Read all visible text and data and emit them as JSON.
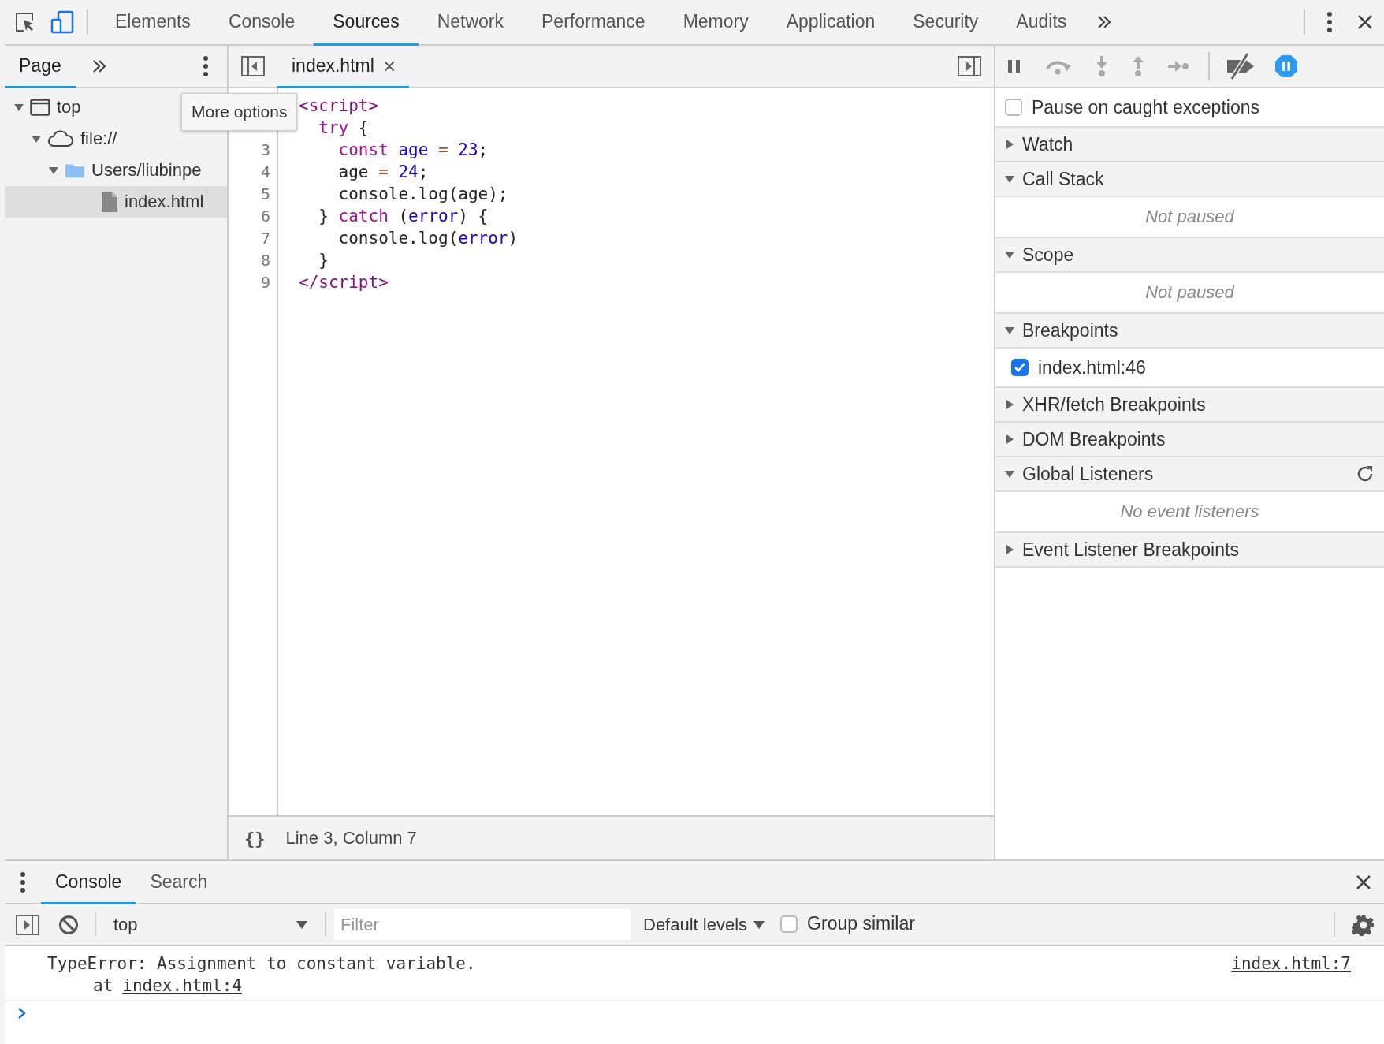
{
  "devtools_tabs": [
    {
      "label": "Elements",
      "selected": false
    },
    {
      "label": "Console",
      "selected": false
    },
    {
      "label": "Sources",
      "selected": true
    },
    {
      "label": "Network",
      "selected": false
    },
    {
      "label": "Performance",
      "selected": false
    },
    {
      "label": "Memory",
      "selected": false
    },
    {
      "label": "Application",
      "selected": false
    },
    {
      "label": "Security",
      "selected": false
    },
    {
      "label": "Audits",
      "selected": false
    }
  ],
  "navigator": {
    "tabs": [
      {
        "label": "Page",
        "selected": true
      }
    ],
    "tooltip": "More options",
    "tree": [
      {
        "label": "top",
        "kind": "frame",
        "expanded": true,
        "selected": false,
        "children": [
          {
            "label": "file://",
            "kind": "cloud",
            "expanded": true,
            "selected": false,
            "children": [
              {
                "label": "Users/liubinpe",
                "kind": "folder",
                "expanded": true,
                "selected": false,
                "children": [
                  {
                    "label": "index.html",
                    "kind": "file",
                    "selected": true
                  }
                ]
              }
            ]
          }
        ]
      }
    ]
  },
  "editor": {
    "tabs": [
      {
        "label": "index.html",
        "selected": true
      }
    ],
    "lines": [
      {
        "tokens": [
          {
            "text": "<script>",
            "kind": "tag"
          }
        ]
      },
      {
        "tokens": [
          {
            "text": "  try",
            "kind": "keyword"
          },
          {
            "text": " {",
            "kind": "plain"
          }
        ]
      },
      {
        "number": "3",
        "tokens": [
          {
            "text": "    const",
            "kind": "keyword"
          },
          {
            "text": " age",
            "kind": "variable"
          },
          {
            "text": " =",
            "kind": "operator"
          },
          {
            "text": " 23",
            "kind": "number"
          },
          {
            "text": ";",
            "kind": "plain"
          }
        ]
      },
      {
        "number": "4",
        "tokens": [
          {
            "text": "    age ",
            "kind": "plain"
          },
          {
            "text": "=",
            "kind": "operator"
          },
          {
            "text": " 24",
            "kind": "number"
          },
          {
            "text": ";",
            "kind": "plain"
          }
        ]
      },
      {
        "number": "5",
        "tokens": [
          {
            "text": "    console.log(age);",
            "kind": "plain"
          }
        ]
      },
      {
        "number": "6",
        "tokens": [
          {
            "text": "  } ",
            "kind": "plain"
          },
          {
            "text": "catch",
            "kind": "keyword"
          },
          {
            "text": " (",
            "kind": "plain"
          },
          {
            "text": "error",
            "kind": "variable"
          },
          {
            "text": ") {",
            "kind": "plain"
          }
        ]
      },
      {
        "number": "7",
        "tokens": [
          {
            "text": "    console.log(",
            "kind": "plain"
          },
          {
            "text": "error",
            "kind": "variable"
          },
          {
            "text": ")",
            "kind": "plain"
          }
        ]
      },
      {
        "number": "8",
        "tokens": [
          {
            "text": "  }",
            "kind": "plain"
          }
        ]
      },
      {
        "number": "9",
        "tokens": [
          {
            "text": "</script>",
            "kind": "tag"
          }
        ]
      }
    ],
    "status": {
      "format_button": "{}",
      "position": "Line 3, Column 7"
    }
  },
  "debugger": {
    "items": [
      {
        "kind": "checkbox",
        "label": "Pause on caught exceptions",
        "checked": false
      },
      {
        "kind": "section",
        "label": "Watch",
        "expanded": false
      },
      {
        "kind": "section",
        "label": "Call Stack",
        "expanded": true
      },
      {
        "kind": "empty",
        "label": "Not paused"
      },
      {
        "kind": "section",
        "label": "Scope",
        "expanded": true
      },
      {
        "kind": "empty",
        "label": "Not paused"
      },
      {
        "kind": "section",
        "label": "Breakpoints",
        "expanded": true
      },
      {
        "kind": "breakpoint",
        "label": "index.html:46",
        "checked": true
      },
      {
        "kind": "section",
        "label": "XHR/fetch Breakpoints",
        "expanded": false
      },
      {
        "kind": "section",
        "label": "DOM Breakpoints",
        "expanded": false
      },
      {
        "kind": "section",
        "label": "Global Listeners",
        "expanded": true,
        "refresh": true
      },
      {
        "kind": "empty",
        "label": "No event listeners"
      },
      {
        "kind": "section",
        "label": "Event Listener Breakpoints",
        "expanded": false
      }
    ]
  },
  "drawer": {
    "tabs": [
      {
        "label": "Console",
        "selected": true
      },
      {
        "label": "Search",
        "selected": false
      }
    ],
    "context": "top",
    "filter_placeholder": "Filter",
    "levels": "Default levels",
    "group_similar": {
      "label": "Group similar",
      "checked": false
    },
    "messages": [
      {
        "text": "TypeError: Assignment to constant variable.",
        "stack": [
          {
            "prefix": "at",
            "link": "index.html:4"
          }
        ],
        "source": "index.html:7"
      }
    ]
  }
}
